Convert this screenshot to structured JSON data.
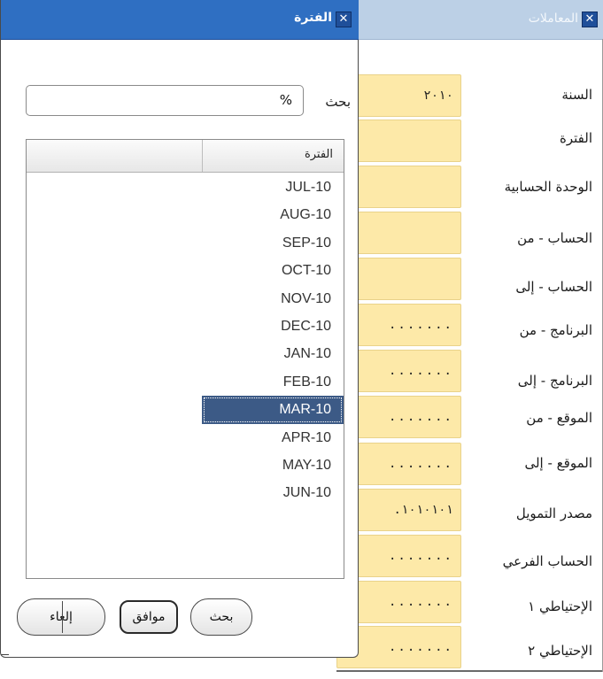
{
  "background_window": {
    "title": "المعاملات",
    "fields": [
      {
        "label": "السنة",
        "value": "٢٠١٠"
      },
      {
        "label": "الفترة",
        "value": ""
      },
      {
        "label": "الوحدة الحسابية",
        "value": ""
      },
      {
        "label": "الحساب - من",
        "value": ""
      },
      {
        "label": "الحساب - إلى",
        "value": ""
      },
      {
        "label": "البرنامج - من",
        "value": "......."
      },
      {
        "label": "البرنامج - إلى",
        "value": "......."
      },
      {
        "label": "الموقع - من",
        "value": "......."
      },
      {
        "label": "الموقع - إلى",
        "value": "......."
      },
      {
        "label": "مصدر التمويل",
        "value": ".١٠١٠١٠١"
      },
      {
        "label": "الحساب الفرعي",
        "value": "......."
      },
      {
        "label": "الإحتياطي ١",
        "value": "......."
      },
      {
        "label": "الإحتياطي ٢",
        "value": "......."
      }
    ]
  },
  "popup": {
    "title": "الفترة",
    "search_label": "بحث",
    "search_value": "%",
    "list_header": "الفترة",
    "items": [
      "JUL-10",
      "AUG-10",
      "SEP-10",
      "OCT-10",
      "NOV-10",
      "DEC-10",
      "JAN-10",
      "FEB-10",
      "MAR-10",
      "APR-10",
      "MAY-10",
      "JUN-10"
    ],
    "selected_item": "MAR-10",
    "buttons": {
      "search": "بحث",
      "ok": "موافق",
      "cancel": "إلغاء"
    }
  }
}
